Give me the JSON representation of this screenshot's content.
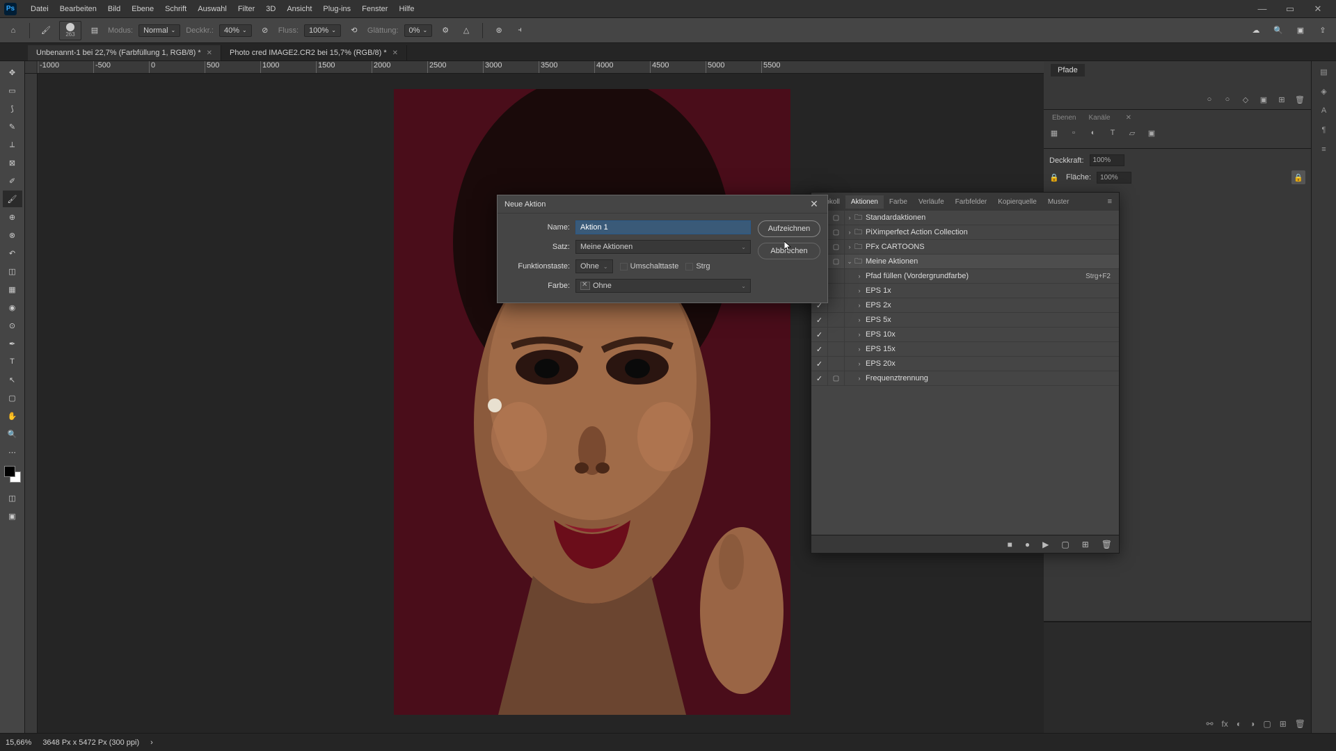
{
  "menu": {
    "items": [
      "Datei",
      "Bearbeiten",
      "Bild",
      "Ebene",
      "Schrift",
      "Auswahl",
      "Filter",
      "3D",
      "Ansicht",
      "Plug-ins",
      "Fenster",
      "Hilfe"
    ]
  },
  "options": {
    "brush_size": "263",
    "mode_lbl": "Modus:",
    "mode": "Normal",
    "opacity_lbl": "Deckkr.:",
    "opacity": "40%",
    "flow_lbl": "Fluss:",
    "flow": "100%",
    "smooth_lbl": "Glättung:",
    "smooth": "0%"
  },
  "tabs": [
    {
      "label": "Unbenannt-1 bei 22,7% (Farbfüllung 1, RGB/8) *"
    },
    {
      "label": "Photo cred IMAGE2.CR2 bei 15,7% (RGB/8) *"
    }
  ],
  "ruler_marks": [
    "-1000",
    "-500",
    "0",
    "500",
    "1000",
    "1500",
    "2000",
    "2500",
    "3000",
    "3500",
    "4000",
    "4500",
    "5000",
    "5500"
  ],
  "right": {
    "paths_tab": "Pfade",
    "layers_tab_a": "Ebenen",
    "layers_tab_b": "Kanäle",
    "opacity_lbl": "Deckkraft:",
    "opacity": "100%",
    "fill_lbl": "Fläche:",
    "fill": "100%"
  },
  "actions_panel": {
    "tabs": [
      "...okoll",
      "Aktionen",
      "Farbe",
      "Verläufe",
      "Farbfelder",
      "Kopierquelle",
      "Muster"
    ],
    "active_tab": 1,
    "sets": [
      {
        "chk": "✓",
        "dlg": "▢",
        "expand": "›",
        "folder": true,
        "name": "Standardaktionen",
        "indent": 0
      },
      {
        "chk": "✓",
        "dlg": "▢",
        "expand": "›",
        "folder": true,
        "name": "PiXimperfect Action Collection",
        "indent": 0
      },
      {
        "chk": "✓",
        "dlg": "▢",
        "expand": "›",
        "folder": true,
        "name": "PFx CARTOONS",
        "indent": 0
      },
      {
        "chk": "✓",
        "dlg": "▢",
        "expand": "⌄",
        "folder": true,
        "name": "Meine Aktionen",
        "indent": 0,
        "open": true
      },
      {
        "chk": "",
        "dlg": "",
        "expand": "›",
        "folder": false,
        "name": "Pfad füllen (Vordergrundfarbe)",
        "shortcut": "Strg+F2",
        "indent": 1
      },
      {
        "chk": "",
        "dlg": "",
        "expand": "›",
        "folder": false,
        "name": "EPS 1x",
        "indent": 1
      },
      {
        "chk": "✓",
        "dlg": "",
        "expand": "›",
        "folder": false,
        "name": "EPS 2x",
        "indent": 1
      },
      {
        "chk": "✓",
        "dlg": "",
        "expand": "›",
        "folder": false,
        "name": "EPS 5x",
        "indent": 1
      },
      {
        "chk": "✓",
        "dlg": "",
        "expand": "›",
        "folder": false,
        "name": "EPS 10x",
        "indent": 1
      },
      {
        "chk": "✓",
        "dlg": "",
        "expand": "›",
        "folder": false,
        "name": "EPS 15x",
        "indent": 1
      },
      {
        "chk": "✓",
        "dlg": "",
        "expand": "›",
        "folder": false,
        "name": "EPS 20x",
        "indent": 1
      },
      {
        "chk": "✓",
        "dlg": "▢",
        "expand": "›",
        "folder": false,
        "name": "Frequenztrennung",
        "indent": 1
      }
    ]
  },
  "dialog": {
    "title": "Neue Aktion",
    "name_lbl": "Name:",
    "name_val": "Aktion 1",
    "set_lbl": "Satz:",
    "set_val": "Meine Aktionen",
    "fkey_lbl": "Funktionstaste:",
    "fkey_val": "Ohne",
    "shift_lbl": "Umschalttaste",
    "ctrl_lbl": "Strg",
    "color_lbl": "Farbe:",
    "color_val": "Ohne",
    "record": "Aufzeichnen",
    "cancel": "Abbrechen"
  },
  "status": {
    "zoom": "15,66%",
    "info": "3648 Px x 5472 Px (300 ppi)"
  }
}
